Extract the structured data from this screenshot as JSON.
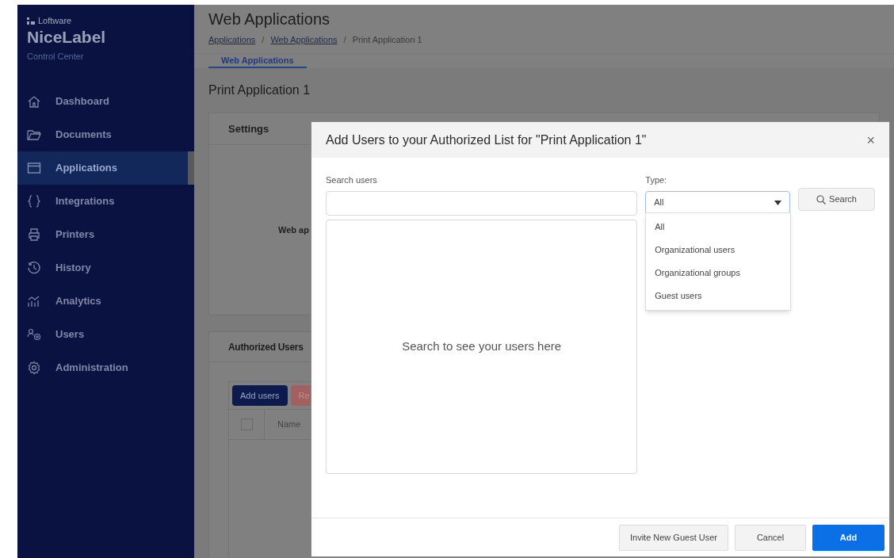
{
  "sidebar": {
    "brand": "Loftware",
    "product": "NiceLabel",
    "subtitle": "Control Center",
    "items": [
      {
        "label": "Dashboard",
        "selected": false
      },
      {
        "label": "Documents",
        "selected": false
      },
      {
        "label": "Applications",
        "selected": true
      },
      {
        "label": "Integrations",
        "selected": false
      },
      {
        "label": "Printers",
        "selected": false
      },
      {
        "label": "History",
        "selected": false
      },
      {
        "label": "Analytics",
        "selected": false
      },
      {
        "label": "Users",
        "selected": false
      },
      {
        "label": "Administration",
        "selected": false
      }
    ]
  },
  "page": {
    "title": "Web Applications",
    "breadcrumb": [
      {
        "label": "Applications",
        "kind": "link"
      },
      {
        "label": "/",
        "kind": "separator"
      },
      {
        "label": "Web Applications",
        "kind": "link"
      },
      {
        "label": "/",
        "kind": "separator"
      },
      {
        "label": "Print Application 1",
        "kind": "current"
      }
    ],
    "tabs": [
      {
        "label": "Web Applications",
        "selected": true
      }
    ],
    "heading": "Print Application 1",
    "settings_card": {
      "title": "Settings",
      "text": "Web ap"
    },
    "authorized_card": {
      "title": "Authorized Users",
      "add_button": "Add users",
      "remove_button": "Re",
      "columns": [
        "Name"
      ],
      "select_all_checked": false
    }
  },
  "dialog": {
    "title": "Add Users to your Authorized List for \"Print Application 1\"",
    "close": "×",
    "search_label": "Search users",
    "empty_text": "Search to see your users here",
    "type_label": "Type:",
    "type_value": "All",
    "type_expanded": true,
    "type_options": [
      "All",
      "Organizational users",
      "Organizational groups",
      "Guest users"
    ],
    "search_button": "Search",
    "buttons": [
      {
        "label": "Invite New Guest User",
        "kind": "secondary"
      },
      {
        "label": "Cancel",
        "kind": "secondary"
      },
      {
        "label": "Add",
        "kind": "primary"
      }
    ]
  }
}
